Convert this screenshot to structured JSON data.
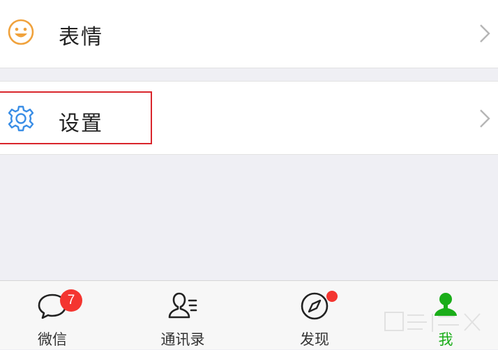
{
  "rows": {
    "emoji": {
      "label": "表情",
      "icon": "emoji-smile-icon",
      "icon_color": "#f0a23c"
    },
    "settings": {
      "label": "设置",
      "icon": "gear-icon",
      "icon_color": "#3a8ee6"
    }
  },
  "tabbar": {
    "chats": {
      "label": "微信",
      "icon": "chat-bubble-icon",
      "badge": "7"
    },
    "contacts": {
      "label": "通讯录",
      "icon": "contacts-icon"
    },
    "discover": {
      "label": "发现",
      "icon": "compass-icon",
      "has_dot": true
    },
    "me": {
      "label": "我",
      "icon": "person-icon",
      "active": true
    }
  },
  "colors": {
    "accent_green": "#1aad19",
    "badge_red": "#f43530",
    "highlight_red": "#d9262c",
    "background_gray": "#efeff4"
  }
}
